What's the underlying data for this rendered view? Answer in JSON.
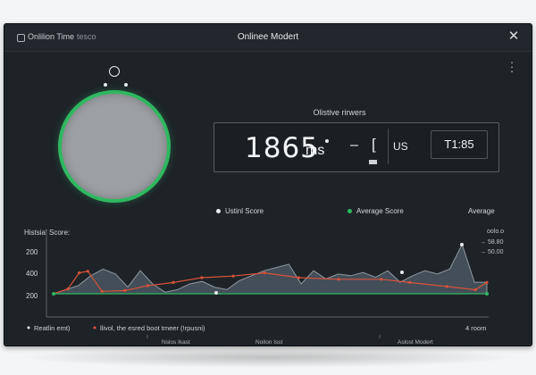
{
  "window": {
    "app_name": "Onlilion Time",
    "app_sub": "tesco",
    "title": "Onlinee Modert"
  },
  "icons": {
    "app": "app-window-icon",
    "close": "close-icon",
    "menu": "kebab-menu-icon",
    "knob": "ring-knob-icon"
  },
  "panel": {
    "title": "Olistive rirwers",
    "value": "1865",
    "unit": "ms",
    "dash": "–",
    "bracket": "[",
    "unit_right": "US",
    "time": "T1:85"
  },
  "legend_top": {
    "item1": "Ustinl Score",
    "item2": "Average Score",
    "item3": "Average"
  },
  "colors": {
    "background": "#1e2328",
    "accent_green": "#2fb760",
    "series_red": "#d9523a",
    "area_fill": "#4a5660",
    "gauge_fill": "#9c9fa3"
  },
  "chart_data": {
    "type": "area",
    "title": "Histsial Score:",
    "y_ticks": [
      "200",
      "400",
      "200"
    ],
    "x_labels": [
      "Nslos Ikast",
      "Noilon Isst",
      "Aslost Modert"
    ],
    "right_labels": [
      "oolo.o",
      "→ 58.80",
      "→ 50.00"
    ],
    "legend": {
      "white": "Reatlin emt)",
      "red": "llivol, the esred boot tmeer (!rpusni)"
    },
    "legend_right": "4 room",
    "x": [
      0,
      1,
      2,
      3,
      4,
      5,
      6,
      7,
      8,
      9,
      10,
      11,
      12,
      13,
      14,
      15,
      16,
      17,
      18,
      19,
      20,
      21,
      22,
      23,
      24,
      25,
      26,
      27,
      28,
      29,
      30,
      31,
      32,
      33,
      34,
      35
    ],
    "series": [
      {
        "values": [
          0,
          5,
          10,
          22,
          30,
          24,
          8,
          28,
          12,
          2,
          5,
          12,
          15,
          8,
          5,
          16,
          22,
          28,
          32,
          36,
          12,
          28,
          18,
          24,
          22,
          26,
          20,
          28,
          14,
          22,
          28,
          24,
          30,
          60,
          14,
          14
        ],
        "color": "#8e989f"
      },
      {
        "values": [
          null,
          null,
          6,
          null,
          null,
          null,
          null,
          null,
          null,
          null,
          null,
          null,
          null,
          null,
          null,
          8,
          null,
          null,
          null,
          null,
          null,
          null,
          null,
          null,
          null,
          null,
          null,
          null,
          null,
          null,
          null,
          null,
          null,
          null,
          null,
          null
        ],
        "color": "#d9523a"
      }
    ],
    "red_series": [
      [
        0,
        0
      ],
      [
        5,
        6
      ],
      [
        9,
        26
      ],
      [
        12,
        28
      ],
      [
        17,
        3
      ],
      [
        25,
        4
      ],
      [
        33,
        10
      ],
      [
        42,
        14
      ],
      [
        52,
        20
      ],
      [
        63,
        22
      ],
      [
        74,
        26
      ],
      [
        86,
        20
      ],
      [
        100,
        18
      ],
      [
        115,
        18
      ],
      [
        125,
        14
      ],
      [
        138,
        9
      ],
      [
        148,
        5
      ],
      [
        152,
        14
      ]
    ],
    "green_baseline": 0
  }
}
